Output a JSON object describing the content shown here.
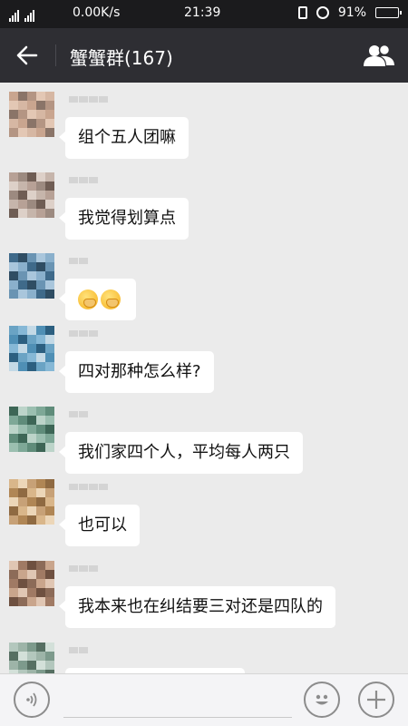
{
  "status_bar": {
    "net_speed": "0.00K/s",
    "time": "21:39",
    "battery": "91%",
    "battery_level": 0.91
  },
  "header": {
    "title": "蟹蟹群(167)"
  },
  "messages": [
    {
      "text": "组个五人团嘛"
    },
    {
      "text": "我觉得划算点"
    },
    {
      "text": "",
      "emoji": "face-with-hand-over-mouth",
      "emoji_count": 2
    },
    {
      "text": "四对那种怎么样?"
    },
    {
      "text": "我们家四个人，平均每人两只"
    },
    {
      "text": "也可以"
    },
    {
      "text": "我本来也在纠结要三对还是四队的"
    },
    {
      "text": ""
    }
  ],
  "input_bar": {
    "placeholder": ""
  },
  "icons": {
    "back": "arrow-left-icon",
    "members": "group-members-icon",
    "voice": "voice-input-icon",
    "emoji": "smiley-icon",
    "more": "plus-icon"
  },
  "colors": {
    "title_bar": "#2e2e33",
    "status_bar": "#1b1b1d",
    "chat_background": "#ebebeb",
    "bubble": "#ffffff"
  }
}
